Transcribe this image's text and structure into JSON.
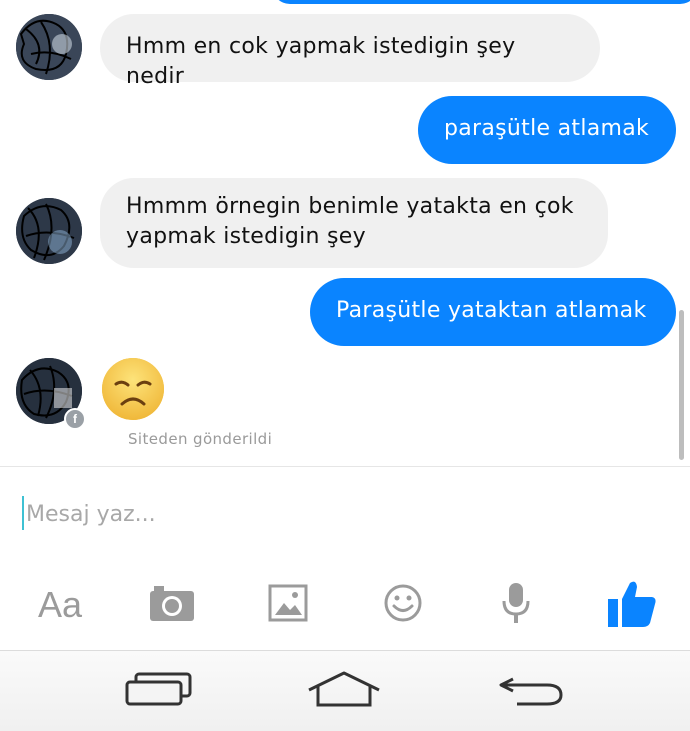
{
  "messages": [
    {
      "from": "them",
      "text": "Hmm en cok yapmak istedigin şey nedir"
    },
    {
      "from": "me",
      "text": "paraşütle atlamak"
    },
    {
      "from": "them",
      "text": "Hmmm örnegin benimle yatakta en çok yapmak istedigin şey"
    },
    {
      "from": "me",
      "text": "Paraşütle yataktan atlamak"
    },
    {
      "from": "them",
      "emoji": "disappointed-face"
    }
  ],
  "status": {
    "sent_from": "Siteden gönderildi"
  },
  "composer": {
    "placeholder": "Mesaj yaz..."
  },
  "toolbar": {
    "font_label": "Aa",
    "icons": [
      "camera-icon",
      "image-icon",
      "emoji-icon",
      "microphone-icon",
      "thumbs-up-icon"
    ]
  },
  "navbar": {
    "icons": [
      "recent-apps-icon",
      "home-icon",
      "back-icon"
    ]
  },
  "colors": {
    "accent": "#0a84ff",
    "incoming_bubble": "#f0f0f0",
    "icon_gray": "#9b9b9b"
  }
}
